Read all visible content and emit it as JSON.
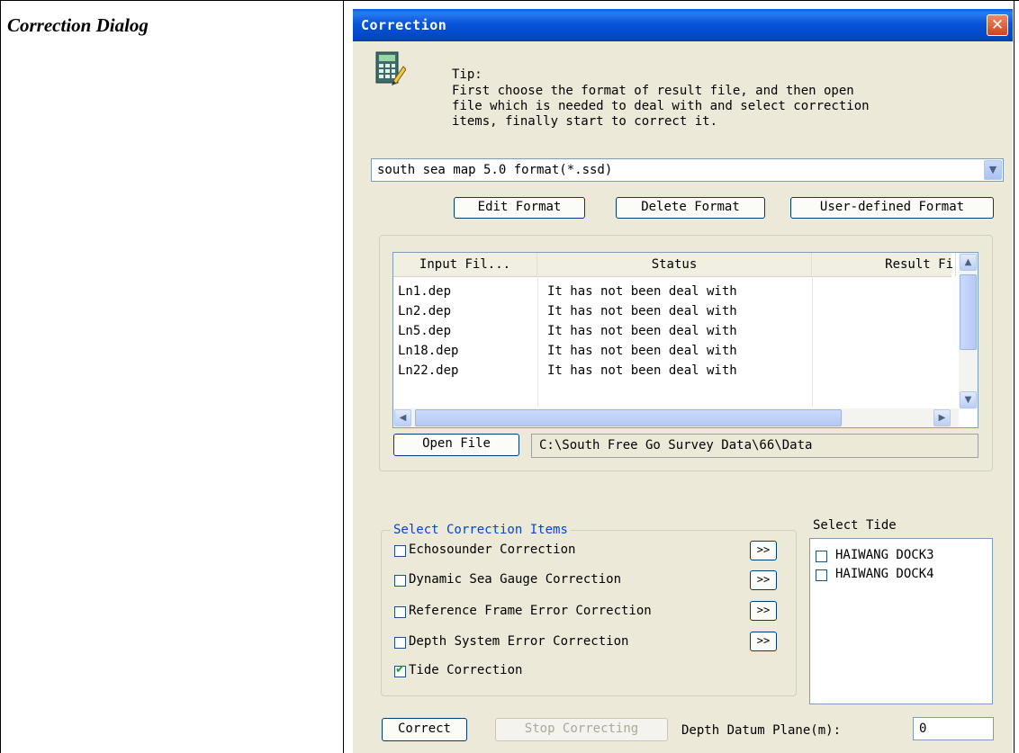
{
  "document": {
    "caption": "Correction Dialog"
  },
  "dialog": {
    "title": "Correction",
    "close_icon": "close-icon",
    "tip_label": "Tip:",
    "tip_text": "First choose the format of result file, and then open\nfile which is needed to deal with and select correction\nitems, finally start to correct it.",
    "tip_icon": "calculator-edit-icon",
    "format_value": "south sea map 5.0 format(*.ssd)",
    "buttons": {
      "edit_format": "Edit Format",
      "delete_format": "Delete Format",
      "user_defined_format": "User-defined Format",
      "open_file": "Open File",
      "correct": "Correct",
      "stop_correcting": "Stop Correcting"
    },
    "file_list": {
      "columns": [
        "Input Fil...",
        "Status",
        "Result Fi"
      ],
      "rows": [
        {
          "input": "Ln1.dep",
          "status": "It has not been deal with",
          "result": ""
        },
        {
          "input": "Ln2.dep",
          "status": "It has not been deal with",
          "result": ""
        },
        {
          "input": "Ln5.dep",
          "status": "It has not been deal with",
          "result": ""
        },
        {
          "input": "Ln18.dep",
          "status": "It has not been deal with",
          "result": ""
        },
        {
          "input": "Ln22.dep",
          "status": "It has not been deal with",
          "result": ""
        }
      ]
    },
    "folder_path": "C:\\South Free Go Survey Data\\66\\Data",
    "correction_items": {
      "legend": "Select Correction Items",
      "arrow_label": ">>",
      "items": [
        {
          "label": "Echosounder Correction",
          "checked": false
        },
        {
          "label": "Dynamic Sea Gauge Correction",
          "checked": false
        },
        {
          "label": "Reference Frame Error Correction",
          "checked": false
        },
        {
          "label": "Depth System Error Correction",
          "checked": false
        },
        {
          "label": "Tide Correction",
          "checked": true
        }
      ]
    },
    "tide": {
      "label": "Select Tide",
      "items": [
        {
          "name": "HAIWANG DOCK3",
          "checked": false
        },
        {
          "name": "HAIWANG DOCK4",
          "checked": false
        }
      ]
    },
    "depth_datum": {
      "label": "Depth Datum Plane(m):",
      "value": "0"
    }
  }
}
